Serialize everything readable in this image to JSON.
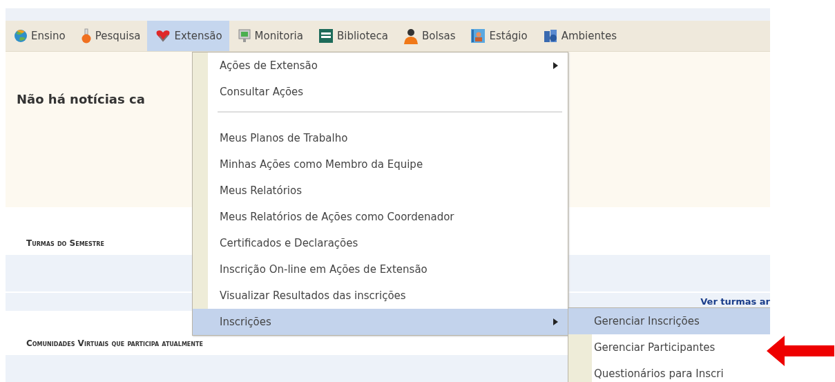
{
  "menu_bar": [
    {
      "label": "Ensino",
      "selected": false
    },
    {
      "label": "Pesquisa",
      "selected": false
    },
    {
      "label": "Extensão",
      "selected": true
    },
    {
      "label": "Monitoria",
      "selected": false
    },
    {
      "label": "Biblioteca",
      "selected": false
    },
    {
      "label": "Bolsas",
      "selected": false
    },
    {
      "label": "Estágio",
      "selected": false
    },
    {
      "label": "Ambientes"
    }
  ],
  "news": "Não há notícias ca",
  "dropdown": [
    {
      "kind": "item",
      "label": "Ações de Extensão",
      "submenu": true,
      "selected": false
    },
    {
      "kind": "item",
      "label": "Consultar Ações",
      "submenu": false,
      "selected": false
    },
    {
      "kind": "separator"
    },
    {
      "kind": "item",
      "label": "Meus Planos de Trabalho",
      "submenu": false,
      "selected": false
    },
    {
      "kind": "item",
      "label": "Minhas Ações como Membro da Equipe",
      "submenu": false,
      "selected": false
    },
    {
      "kind": "item",
      "label": "Meus Relatórios",
      "submenu": false,
      "selected": false
    },
    {
      "kind": "item",
      "label": "Meus Relatórios de Ações como Coordenador",
      "submenu": false,
      "selected": false
    },
    {
      "kind": "item",
      "label": "Certificados e Declarações",
      "submenu": false,
      "selected": false
    },
    {
      "kind": "item",
      "label": "Inscrição On-line em Ações de Extensão",
      "submenu": false,
      "selected": false
    },
    {
      "kind": "item",
      "label": "Visualizar Resultados das inscrições",
      "submenu": false,
      "selected": false
    },
    {
      "kind": "item",
      "label": "Inscrições",
      "submenu": true,
      "selected": true
    }
  ],
  "submenu": [
    {
      "label": "Gerenciar Inscrições",
      "selected": true
    },
    {
      "label": "Gerenciar Participantes",
      "selected": false
    },
    {
      "label": "Questionários para Inscri",
      "selected": false
    }
  ],
  "sections": [
    {
      "title": "Turmas do Semestre",
      "link": "Ver turmas ar"
    },
    {
      "title": "Comunidades Virtuais que participa atualmente"
    }
  ]
}
